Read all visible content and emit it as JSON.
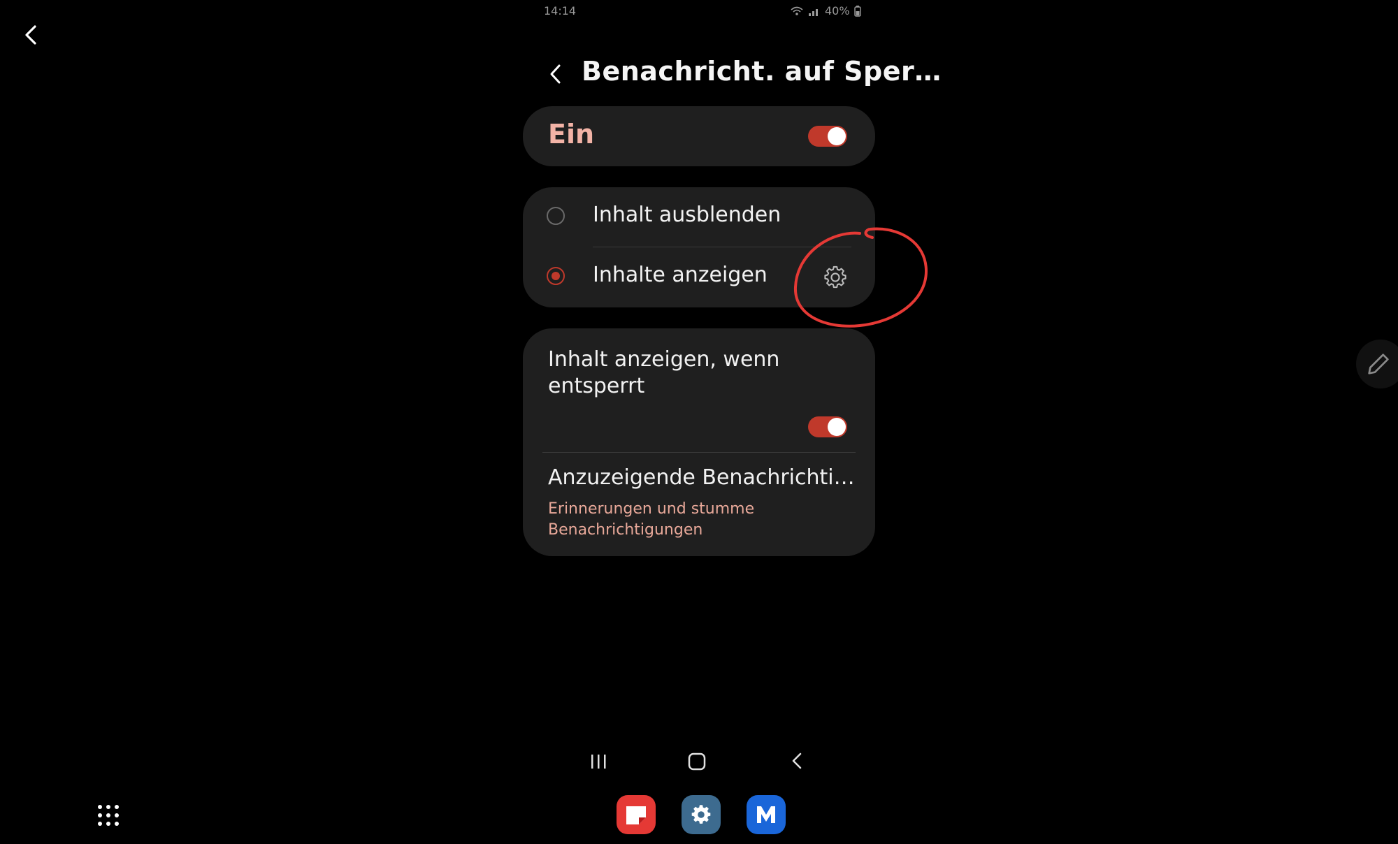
{
  "status_bar": {
    "time": "14:14",
    "battery": "40%"
  },
  "header": {
    "title": "Benachricht. auf Sper…"
  },
  "main_toggle": {
    "label": "Ein",
    "state": "on"
  },
  "display_options": {
    "selected_index": 1,
    "items": [
      {
        "label": "Inhalt ausblenden"
      },
      {
        "label": "Inhalte anzeigen"
      }
    ]
  },
  "content_settings": {
    "show_when_unlocked": {
      "label": "Inhalt anzeigen, wenn entsperrt",
      "state": "on"
    },
    "notifications_to_show": {
      "title": "Anzuzeigende Benachrichtigu…",
      "description": "Erinnerungen und stumme Benachrichtigungen"
    }
  },
  "colors": {
    "accent": "#c0392b",
    "accent_text": "#f2b3a6",
    "card": "#1f1f1f",
    "background": "#000000",
    "annotation": "#e53935"
  },
  "icons": {
    "gear": "gear-icon",
    "back": "chevron-left-icon",
    "recents": "recents-icon",
    "home": "home-icon",
    "edit": "pencil-icon",
    "apps": "apps-grid-icon"
  },
  "dock": {
    "apps": [
      {
        "name": "samsung-notes-app-icon",
        "color": "#e53935"
      },
      {
        "name": "settings-app-icon",
        "color": "#3d6b8f"
      },
      {
        "name": "m-app-icon",
        "color": "#1a66d9"
      }
    ]
  }
}
